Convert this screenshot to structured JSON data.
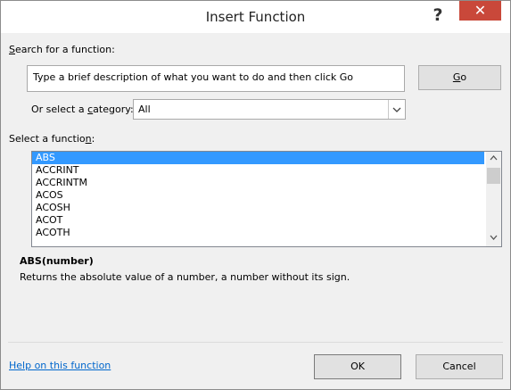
{
  "window": {
    "title": "Insert Function",
    "help_glyph": "?",
    "close_glyph": "✕"
  },
  "search": {
    "label_first": "S",
    "label_rest": "earch for a function:",
    "value": "Type a brief description of what you want to do and then click Go",
    "go_first": "G",
    "go_rest": "o"
  },
  "category": {
    "label_before": "Or select a ",
    "label_underline": "c",
    "label_after": "ategory:",
    "selected": "All"
  },
  "functions": {
    "label_before": "Select a functio",
    "label_underline": "n",
    "label_after": ":",
    "items": [
      "ABS",
      "ACCRINT",
      "ACCRINTM",
      "ACOS",
      "ACOSH",
      "ACOT",
      "ACOTH"
    ],
    "selected_index": 0
  },
  "details": {
    "signature": "ABS(number)",
    "description": "Returns the absolute value of a number, a number without its sign."
  },
  "footer": {
    "help_link": "Help on this function",
    "ok": "OK",
    "cancel": "Cancel"
  },
  "icons": {
    "dropdown": "chevron-down-icon",
    "scroll_up": "chevron-up-icon",
    "scroll_down": "chevron-down-icon"
  },
  "colors": {
    "selection": "#3399ff",
    "close_button": "#c9483a",
    "link": "#0066cc"
  }
}
